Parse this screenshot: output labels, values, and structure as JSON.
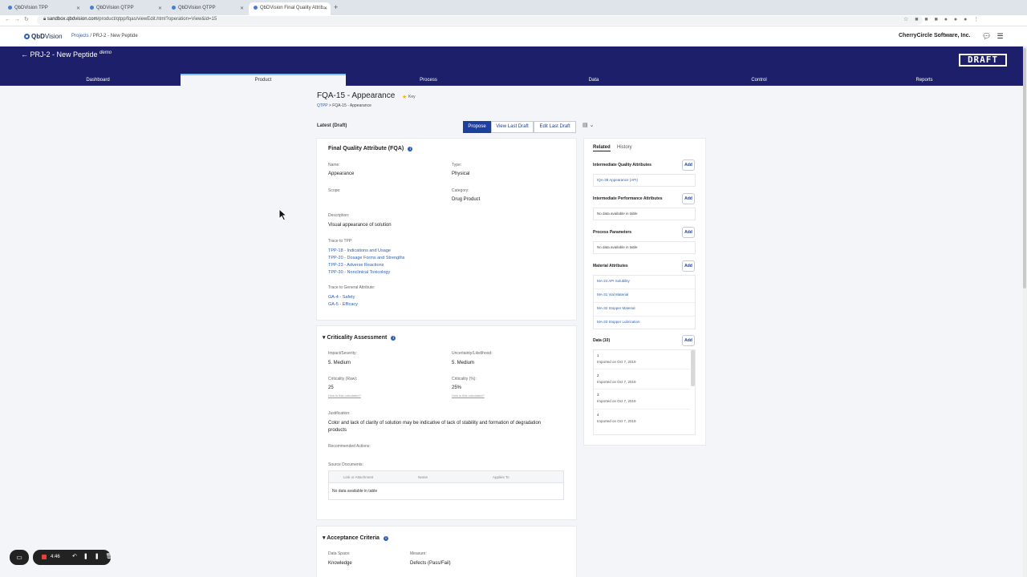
{
  "browser": {
    "tabs": [
      {
        "title": "QbDVision TPP",
        "active": false
      },
      {
        "title": "QbDVision QTPP",
        "active": false
      },
      {
        "title": "QbDVision QTPP",
        "active": false
      },
      {
        "title": "QbDVision Final Quality Attrib...",
        "active": true
      }
    ],
    "new_tab": "+",
    "url_host": "sandbox.qbdvision.com",
    "url_path": "/product/qtpp/fqas/viewEdit.html?operation=View&id=15",
    "nav": "←→↻"
  },
  "app": {
    "logo_prefix": "QbD",
    "logo_suffix": "Vision",
    "breadcrumb_link": "Projects",
    "breadcrumb_current": " / PRJ-2 - New Peptide",
    "company": "CherryCircle Software, Inc.",
    "project_title": "← PRJ-2 - New Peptide ",
    "project_tag": "demo",
    "draft_stamp": "DRAFT",
    "tabs": [
      "Dashboard",
      "Product",
      "Process",
      "Data",
      "Control",
      "Reports"
    ],
    "active_tab": "Product"
  },
  "page": {
    "title": "FQA-15 - Appearance",
    "key_label": "Key",
    "crumb_link": "QTPP",
    "crumb_current": " > FQA-15 - Appearance",
    "version_label": "Latest (Draft)",
    "buttons": {
      "propose": "Propose",
      "view_last_draft": "View Last Draft",
      "edit_last_draft": "Edit Last Draft"
    }
  },
  "fqa": {
    "header": "Final Quality Attribute (FQA)",
    "name_label": "Name:",
    "name": "Appearance",
    "type_label": "Type:",
    "type": "Physical",
    "scope_label": "Scope:",
    "category_label": "Category:",
    "category": "Drug Product",
    "description_label": "Description:",
    "description": "Visual appearance of solution",
    "trace_tpp_label": "Trace to TPP:",
    "trace_tpp": [
      "TPP-18 - Indications and Usage",
      "TPP-20 - Dosage Forms and Strengths",
      "TPP-23 - Adverse Reactions",
      "TPP-30 - Nonclinical Toxicology"
    ],
    "trace_ga_label": "Trace to General Attribute:",
    "trace_ga": [
      "GA-4 - Safety",
      "GA-5 - Efficacy"
    ]
  },
  "criticality": {
    "header": "Criticality Assessment",
    "impact_label": "Impact/Severity:",
    "impact": "5. Medium",
    "uncertainty_label": "Uncertainty/Likelihood:",
    "uncertainty": "5. Medium",
    "raw_label": "Criticality (Raw):",
    "raw": "25",
    "pct_label": "Criticality (%):",
    "pct": "25%",
    "calc_hint": "How is this calculated?",
    "justification_label": "Justification:",
    "justification_line1": "Color and lack of clarity of solution may be indicative of lack of stability and formation of degradation",
    "justification_line2": "products",
    "recommended_label": "Recommended Actions:",
    "source_label": "Source Documents:",
    "table_headers": [
      "Link or Attachment",
      "Name",
      "Applies To"
    ],
    "table_empty": "No data available in table"
  },
  "acceptance": {
    "header": "Acceptance Criteria",
    "data_space_label": "Data Space:",
    "data_space": "Knowledge",
    "measure_label": "Measure:",
    "measure": "Defects (Pass/Fail)"
  },
  "related": {
    "tab_related": "Related",
    "tab_history": "History",
    "add_label": "Add",
    "iqa_header": "Intermediate Quality Attributes",
    "iqa_items": [
      "IQA-38 Appearance (API)"
    ],
    "ipa_header": "Intermediate Performance Attributes",
    "ipa_empty": "No data available in table",
    "pp_header": "Process Parameters",
    "pp_empty": "No data available in table",
    "ma_header": "Material Attributes",
    "ma_items": [
      "MA-24 API Solubility",
      "MA-31 Vial Material",
      "MA-32 Stopper Material",
      "MA-33 Stopper Lubrication"
    ],
    "data_header": "Data (10)",
    "data_items": [
      {
        "num": "1",
        "sub": "Imported on Oct 7, 2019"
      },
      {
        "num": "2",
        "sub": "Imported on Oct 7, 2019"
      },
      {
        "num": "3",
        "sub": "Imported on Oct 7, 2019"
      },
      {
        "num": "4",
        "sub": "Imported on Oct 7, 2019"
      }
    ]
  },
  "recorder": {
    "time": "4:46"
  },
  "colors": {
    "nav_bg": "#1d1f6b",
    "accent": "#1d3f9e",
    "link": "#2b5fb5",
    "key_star": "#f2b705"
  }
}
